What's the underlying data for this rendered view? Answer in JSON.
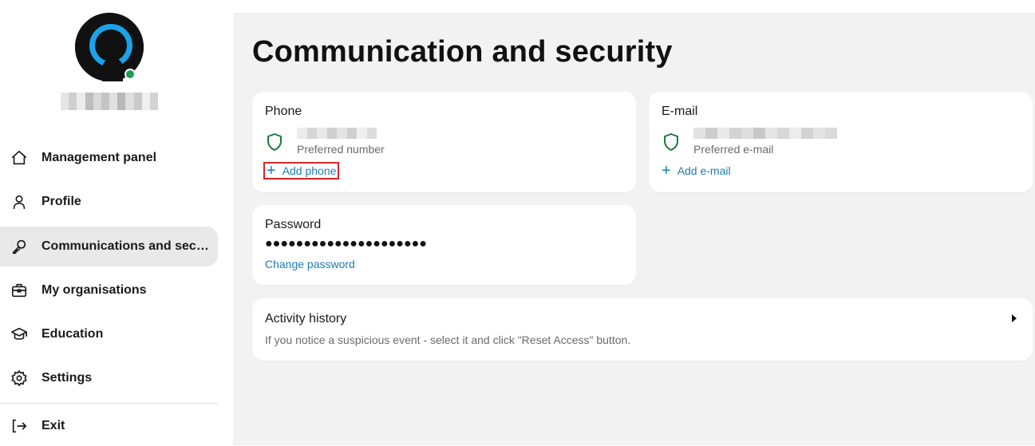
{
  "sidebar": {
    "user": {
      "avatar_icon": "user-silhouette-avatar",
      "status": "online",
      "status_color": "#1f9d55"
    },
    "items": [
      {
        "label": "Management panel",
        "icon": "home-icon"
      },
      {
        "label": "Profile",
        "icon": "person-icon"
      },
      {
        "label": "Communications and security",
        "icon": "key-icon",
        "active": true
      },
      {
        "label": "My organisations",
        "icon": "briefcase-icon"
      },
      {
        "label": "Education",
        "icon": "graduation-cap-icon"
      },
      {
        "label": "Settings",
        "icon": "gear-icon"
      },
      {
        "label": "Exit",
        "icon": "logout-icon"
      }
    ]
  },
  "main": {
    "title": "Communication and security",
    "phone_card": {
      "title": "Phone",
      "sub_label": "Preferred number",
      "add_label": "Add phone"
    },
    "email_card": {
      "title": "E-mail",
      "sub_label": "Preferred e-mail",
      "add_label": "Add e-mail"
    },
    "password_card": {
      "title": "Password",
      "masked_value": "●●●●●●●●●●●●●●●●●●●●●",
      "change_label": "Change password"
    },
    "activity_card": {
      "title": "Activity history",
      "description": "If you notice a suspicious event - select it and click \"Reset Access\" button."
    }
  },
  "colors": {
    "accent_link": "#1f7db3",
    "shield_green": "#1b7a3e",
    "active_nav_bg": "#e9e9e9",
    "main_bg": "#f2f2f2",
    "highlight_box": "#d42626",
    "avatar_blue": "#1aa3e8"
  }
}
